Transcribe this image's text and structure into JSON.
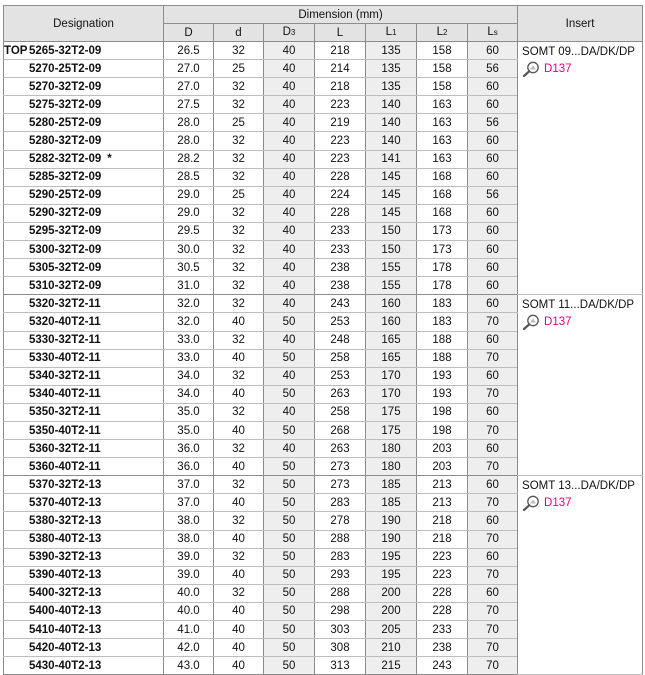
{
  "header": {
    "designation": "Designation",
    "dimension": "Dimension (mm)",
    "insert": "Insert",
    "cols": [
      {
        "main": "D",
        "sub": ""
      },
      {
        "main": "d",
        "sub": ""
      },
      {
        "main": "D",
        "sub": "3"
      },
      {
        "main": "L",
        "sub": ""
      },
      {
        "main": "L",
        "sub": "1"
      },
      {
        "main": "L",
        "sub": "2"
      },
      {
        "main": "L",
        "sub": "s"
      }
    ]
  },
  "groups": [
    {
      "insert": "SOMT 09...DA/DK/DP",
      "ref": "D137",
      "rows": [
        {
          "prefix": "TOP",
          "code": "5265-32T2-09",
          "mark": "",
          "v": [
            "26.5",
            "32",
            "40",
            "218",
            "135",
            "158",
            "60"
          ]
        },
        {
          "prefix": "",
          "code": "5270-25T2-09",
          "mark": "",
          "v": [
            "27.0",
            "25",
            "40",
            "214",
            "135",
            "158",
            "56"
          ]
        },
        {
          "prefix": "",
          "code": "5270-32T2-09",
          "mark": "",
          "v": [
            "27.0",
            "32",
            "40",
            "218",
            "135",
            "158",
            "60"
          ]
        },
        {
          "prefix": "",
          "code": "5275-32T2-09",
          "mark": "",
          "v": [
            "27.5",
            "32",
            "40",
            "223",
            "140",
            "163",
            "60"
          ]
        },
        {
          "prefix": "",
          "code": "5280-25T2-09",
          "mark": "",
          "v": [
            "28.0",
            "25",
            "40",
            "219",
            "140",
            "163",
            "56"
          ]
        },
        {
          "prefix": "",
          "code": "5280-32T2-09",
          "mark": "",
          "v": [
            "28.0",
            "32",
            "40",
            "223",
            "140",
            "163",
            "60"
          ]
        },
        {
          "prefix": "",
          "code": "5282-32T2-09",
          "mark": "*",
          "v": [
            "28.2",
            "32",
            "40",
            "223",
            "141",
            "163",
            "60"
          ]
        },
        {
          "prefix": "",
          "code": "5285-32T2-09",
          "mark": "",
          "v": [
            "28.5",
            "32",
            "40",
            "228",
            "145",
            "168",
            "60"
          ]
        },
        {
          "prefix": "",
          "code": "5290-25T2-09",
          "mark": "",
          "v": [
            "29.0",
            "25",
            "40",
            "224",
            "145",
            "168",
            "56"
          ]
        },
        {
          "prefix": "",
          "code": "5290-32T2-09",
          "mark": "",
          "v": [
            "29.0",
            "32",
            "40",
            "228",
            "145",
            "168",
            "60"
          ]
        },
        {
          "prefix": "",
          "code": "5295-32T2-09",
          "mark": "",
          "v": [
            "29.5",
            "32",
            "40",
            "233",
            "150",
            "173",
            "60"
          ]
        },
        {
          "prefix": "",
          "code": "5300-32T2-09",
          "mark": "",
          "v": [
            "30.0",
            "32",
            "40",
            "233",
            "150",
            "173",
            "60"
          ]
        },
        {
          "prefix": "",
          "code": "5305-32T2-09",
          "mark": "",
          "v": [
            "30.5",
            "32",
            "40",
            "238",
            "155",
            "178",
            "60"
          ]
        },
        {
          "prefix": "",
          "code": "5310-32T2-09",
          "mark": "",
          "v": [
            "31.0",
            "32",
            "40",
            "238",
            "155",
            "178",
            "60"
          ]
        }
      ]
    },
    {
      "insert": "SOMT 11...DA/DK/DP",
      "ref": "D137",
      "rows": [
        {
          "prefix": "",
          "code": "5320-32T2-11",
          "mark": "",
          "v": [
            "32.0",
            "32",
            "40",
            "243",
            "160",
            "183",
            "60"
          ]
        },
        {
          "prefix": "",
          "code": "5320-40T2-11",
          "mark": "",
          "v": [
            "32.0",
            "40",
            "50",
            "253",
            "160",
            "183",
            "70"
          ]
        },
        {
          "prefix": "",
          "code": "5330-32T2-11",
          "mark": "",
          "v": [
            "33.0",
            "32",
            "40",
            "248",
            "165",
            "188",
            "60"
          ]
        },
        {
          "prefix": "",
          "code": "5330-40T2-11",
          "mark": "",
          "v": [
            "33.0",
            "40",
            "50",
            "258",
            "165",
            "188",
            "70"
          ]
        },
        {
          "prefix": "",
          "code": "5340-32T2-11",
          "mark": "",
          "v": [
            "34.0",
            "32",
            "40",
            "253",
            "170",
            "193",
            "60"
          ]
        },
        {
          "prefix": "",
          "code": "5340-40T2-11",
          "mark": "",
          "v": [
            "34.0",
            "40",
            "50",
            "263",
            "170",
            "193",
            "70"
          ]
        },
        {
          "prefix": "",
          "code": "5350-32T2-11",
          "mark": "",
          "v": [
            "35.0",
            "32",
            "40",
            "258",
            "175",
            "198",
            "60"
          ]
        },
        {
          "prefix": "",
          "code": "5350-40T2-11",
          "mark": "",
          "v": [
            "35.0",
            "40",
            "50",
            "268",
            "175",
            "198",
            "70"
          ]
        },
        {
          "prefix": "",
          "code": "5360-32T2-11",
          "mark": "",
          "v": [
            "36.0",
            "32",
            "40",
            "263",
            "180",
            "203",
            "60"
          ]
        },
        {
          "prefix": "",
          "code": "5360-40T2-11",
          "mark": "",
          "v": [
            "36.0",
            "40",
            "50",
            "273",
            "180",
            "203",
            "70"
          ]
        }
      ]
    },
    {
      "insert": "SOMT 13...DA/DK/DP",
      "ref": "D137",
      "rows": [
        {
          "prefix": "",
          "code": "5370-32T2-13",
          "mark": "",
          "v": [
            "37.0",
            "32",
            "50",
            "273",
            "185",
            "213",
            "60"
          ]
        },
        {
          "prefix": "",
          "code": "5370-40T2-13",
          "mark": "",
          "v": [
            "37.0",
            "40",
            "50",
            "283",
            "185",
            "213",
            "70"
          ]
        },
        {
          "prefix": "",
          "code": "5380-32T2-13",
          "mark": "",
          "v": [
            "38.0",
            "32",
            "50",
            "278",
            "190",
            "218",
            "60"
          ]
        },
        {
          "prefix": "",
          "code": "5380-40T2-13",
          "mark": "",
          "v": [
            "38.0",
            "40",
            "50",
            "288",
            "190",
            "218",
            "70"
          ]
        },
        {
          "prefix": "",
          "code": "5390-32T2-13",
          "mark": "",
          "v": [
            "39.0",
            "32",
            "50",
            "283",
            "195",
            "223",
            "60"
          ]
        },
        {
          "prefix": "",
          "code": "5390-40T2-13",
          "mark": "",
          "v": [
            "39.0",
            "40",
            "50",
            "293",
            "195",
            "223",
            "70"
          ]
        },
        {
          "prefix": "",
          "code": "5400-32T2-13",
          "mark": "",
          "v": [
            "40.0",
            "32",
            "50",
            "288",
            "200",
            "228",
            "60"
          ]
        },
        {
          "prefix": "",
          "code": "5400-40T2-13",
          "mark": "",
          "v": [
            "40.0",
            "40",
            "50",
            "298",
            "200",
            "228",
            "70"
          ]
        },
        {
          "prefix": "",
          "code": "5410-40T2-13",
          "mark": "",
          "v": [
            "41.0",
            "40",
            "50",
            "303",
            "205",
            "233",
            "70"
          ]
        },
        {
          "prefix": "",
          "code": "5420-40T2-13",
          "mark": "",
          "v": [
            "42.0",
            "40",
            "50",
            "308",
            "210",
            "238",
            "70"
          ]
        },
        {
          "prefix": "",
          "code": "5430-40T2-13",
          "mark": "",
          "v": [
            "43.0",
            "40",
            "50",
            "313",
            "215",
            "243",
            "70"
          ]
        }
      ]
    }
  ],
  "colors": {
    "header_bg": "#e3e3e3",
    "shade_col": "#eeeeee",
    "ref_accent": "#e6007e"
  }
}
